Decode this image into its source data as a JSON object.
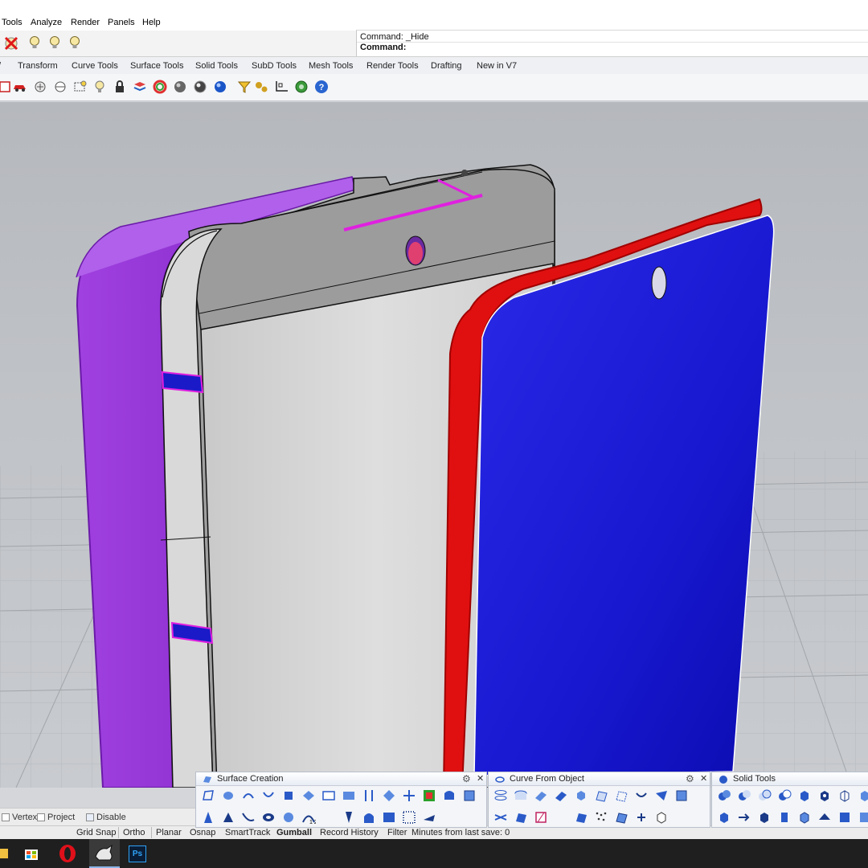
{
  "menu": [
    "Tools",
    "Analyze",
    "Render",
    "Panels",
    "Help"
  ],
  "command": {
    "history": "Command: _Hide",
    "prompt": "Command:"
  },
  "tabs": [
    "Transform",
    "Curve Tools",
    "Surface Tools",
    "Solid Tools",
    "SubD Tools",
    "Mesh Tools",
    "Render Tools",
    "Drafting",
    "New in V7"
  ],
  "panels": {
    "surface_creation": "Surface Creation",
    "curve_from_object": "Curve From Object",
    "solid_tools": "Solid Tools"
  },
  "osnap": {
    "vertex": "Vertex",
    "project": "Project",
    "disable": "Disable"
  },
  "status": [
    "Grid Snap",
    "Ortho",
    "Planar",
    "Osnap",
    "SmartTrack",
    "Gumball",
    "Record History",
    "Filter",
    "Minutes from last save: 0"
  ],
  "taskbar": {
    "photoshop_label": "Ps"
  },
  "colors": {
    "purple_shell": "#8b2fd6",
    "red_frame": "#e01010",
    "blue_screen": "#1515d8",
    "body_gray": "#d6d6d6",
    "accent_blue": "#1a55c8"
  }
}
